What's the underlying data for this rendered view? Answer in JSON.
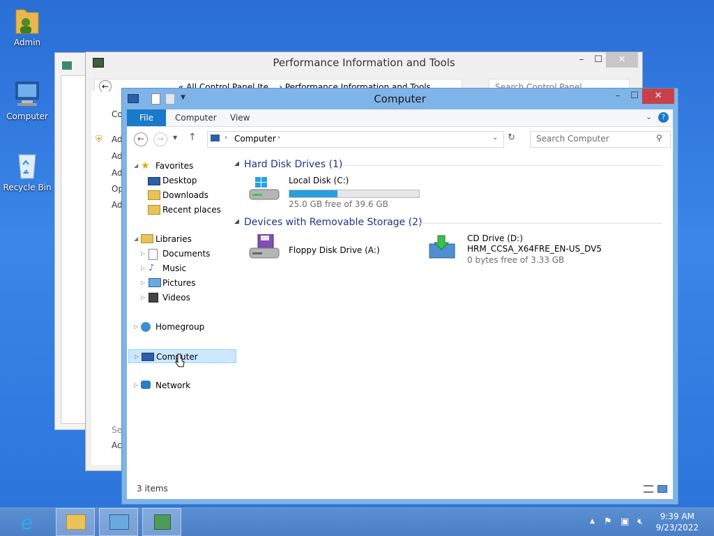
{
  "desktop": {
    "icons": [
      {
        "label": "Admin",
        "icon": "user-folder-icon"
      },
      {
        "label": "Computer",
        "icon": "computer-icon"
      },
      {
        "label": "Recycle Bin",
        "icon": "recycle-bin-icon"
      }
    ]
  },
  "perf_window": {
    "title": "Performance Information and Tools",
    "address": "«  All Control Panel Ite...  ›  Performance Information and Tools",
    "search_placeholder": "Search Control Panel",
    "left_items": [
      "Co",
      "Ad",
      "Ad",
      "Ad",
      "Op",
      "Ad",
      "See",
      "Act"
    ],
    "controls": {
      "minimize": "–",
      "maximize": "☐",
      "close": "✕"
    }
  },
  "computer_window": {
    "title": "Computer",
    "controls": {
      "minimize": "–",
      "maximize": "☐",
      "close": "✕"
    },
    "ribbon_tabs": {
      "file": "File",
      "computer": "Computer",
      "view": "View"
    },
    "address_path": "Computer",
    "search_placeholder": "Search Computer",
    "nav_tree": {
      "favorites": "Favorites",
      "desktop": "Desktop",
      "downloads": "Downloads",
      "recent": "Recent places",
      "libraries": "Libraries",
      "documents": "Documents",
      "music": "Music",
      "pictures": "Pictures",
      "videos": "Videos",
      "homegroup": "Homegroup",
      "computer": "Computer",
      "network": "Network"
    },
    "groups": {
      "hdd_header": "Hard Disk Drives (1)",
      "removable_header": "Devices with Removable Storage (2)"
    },
    "drives": {
      "local_disk": {
        "name": "Local Disk (C:)",
        "free_text": "25.0 GB free of 39.6 GB",
        "used_fraction": 0.369
      },
      "floppy": {
        "name": "Floppy Disk Drive (A:)"
      },
      "cd": {
        "name": "CD Drive (D:)",
        "label": "HRM_CCSA_X64FRE_EN-US_DV5",
        "free_text": "0 bytes free of 3.33 GB"
      }
    },
    "status": "3 items"
  },
  "taskbar": {
    "buttons": [
      "internet-explorer-icon",
      "file-explorer-icon",
      "control-panel-icon",
      "performance-icon"
    ],
    "time": "9:39 AM",
    "date": "9/23/2022"
  },
  "colors": {
    "accent": "#1979ca",
    "progress": "#26a0da",
    "close_red": "#c8404a"
  }
}
